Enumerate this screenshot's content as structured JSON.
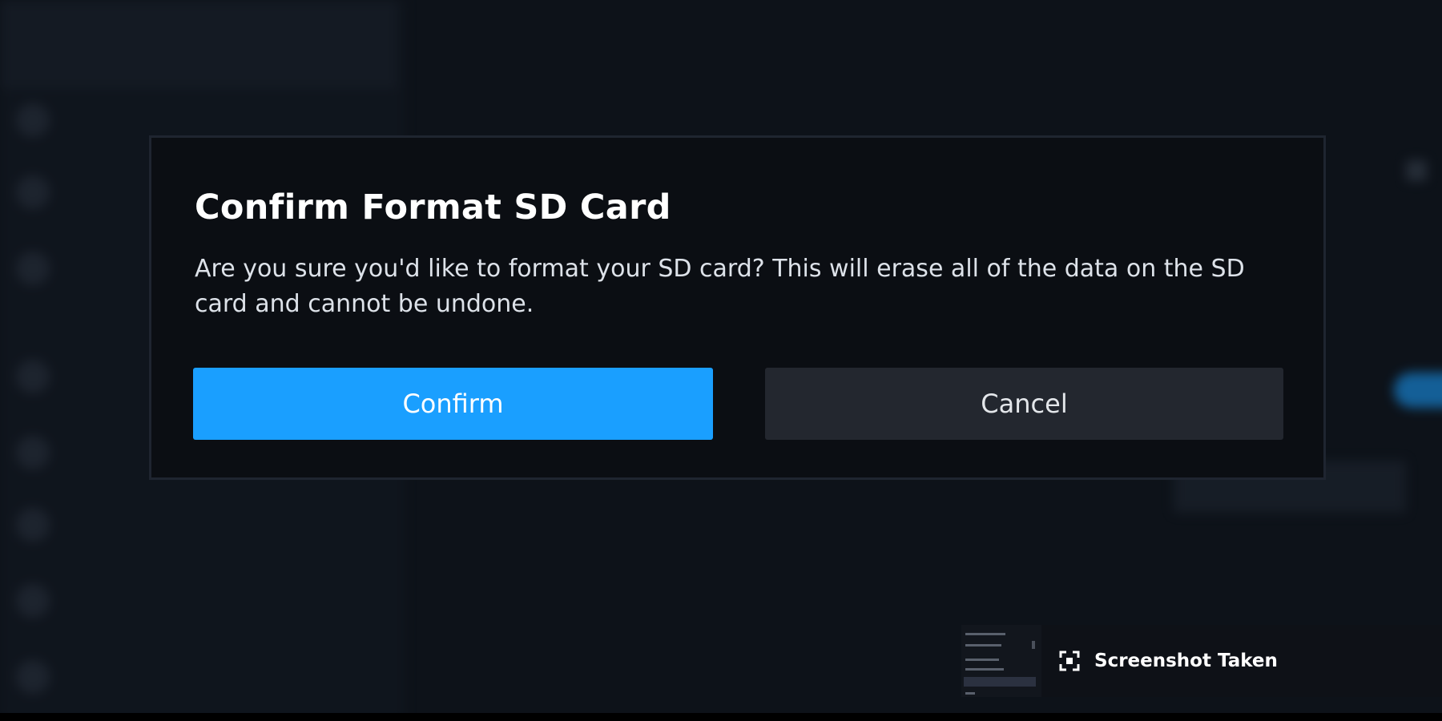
{
  "dialog": {
    "title": "Confirm Format SD Card",
    "message": "Are you sure you'd like to format your SD card? This will erase all of the data on the SD card and cannot be undone.",
    "confirm_label": "Confirm",
    "cancel_label": "Cancel"
  },
  "toast": {
    "text": "Screenshot Taken",
    "icon": "screenshot-icon"
  },
  "colors": {
    "accent": "#1a9fff",
    "dialog_bg": "#0b0e13",
    "cancel_bg": "#23272f"
  }
}
